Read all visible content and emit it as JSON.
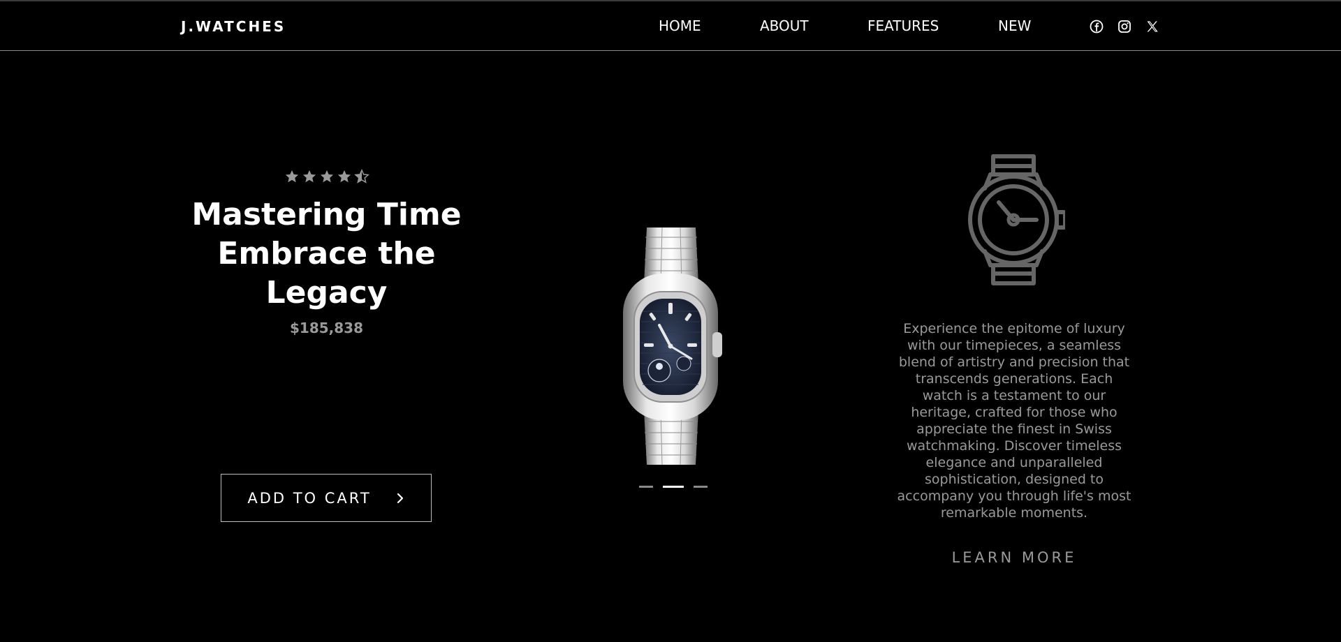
{
  "brand": "J.WATCHES",
  "nav": {
    "items": [
      {
        "label": "HOME"
      },
      {
        "label": "ABOUT"
      },
      {
        "label": "FEATURES"
      },
      {
        "label": "NEW"
      }
    ],
    "social": [
      "facebook-icon",
      "instagram-icon",
      "x-icon"
    ]
  },
  "hero": {
    "rating": 4.5,
    "title_line1": "Mastering Time",
    "title_line2": "Embrace the",
    "title_line3": "Legacy",
    "price": "$185,838",
    "cta_label": "ADD TO CART"
  },
  "carousel": {
    "slides": 3,
    "active_index": 1
  },
  "feature": {
    "description": "Experience the epitome of luxury with our timepieces, a seamless blend of artistry and precision that transcends generations. Each watch is a testament to our heritage, crafted for those who appreciate the finest in Swiss watchmaking. Discover timeless elegance and unparalleled sophistication, designed to accompany you through life's most remarkable moments.",
    "link_label": "LEARN MORE"
  },
  "colors": {
    "background": "#000000",
    "text": "#ffffff",
    "muted": "#9a9a9a",
    "star": "#9a9a9a"
  }
}
